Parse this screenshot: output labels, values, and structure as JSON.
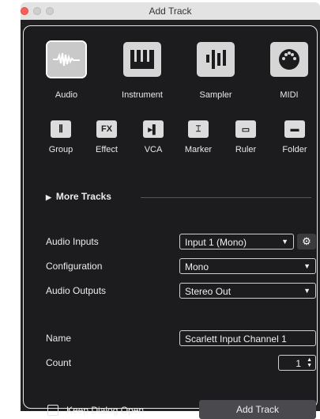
{
  "window": {
    "title": "Add Track"
  },
  "track_types": [
    {
      "label": "Audio",
      "icon": "waveform-icon"
    },
    {
      "label": "Instrument",
      "icon": "piano-keys-icon"
    },
    {
      "label": "Sampler",
      "icon": "sampler-bars-icon"
    },
    {
      "label": "MIDI",
      "icon": "midi-port-icon"
    }
  ],
  "small_types": [
    {
      "label": "Group",
      "glyph": "⫼"
    },
    {
      "label": "Effect",
      "glyph": "FX"
    },
    {
      "label": "VCA",
      "glyph": "▸▌"
    },
    {
      "label": "Marker",
      "glyph": "⌶"
    },
    {
      "label": "Ruler",
      "glyph": "▭"
    },
    {
      "label": "Folder",
      "glyph": "▬"
    }
  ],
  "more_tracks": "More Tracks",
  "fields": {
    "audio_inputs_label": "Audio Inputs",
    "audio_inputs_value": "Input 1 (Mono)",
    "configuration_label": "Configuration",
    "configuration_value": "Mono",
    "audio_outputs_label": "Audio Outputs",
    "audio_outputs_value": "Stereo Out",
    "name_label": "Name",
    "name_value": "Scarlett Input Channel 1",
    "count_label": "Count",
    "count_value": "1"
  },
  "footer": {
    "keep_open_label": "Keep Dialog Open",
    "keep_open_checked": false,
    "add_button_label": "Add Track"
  }
}
